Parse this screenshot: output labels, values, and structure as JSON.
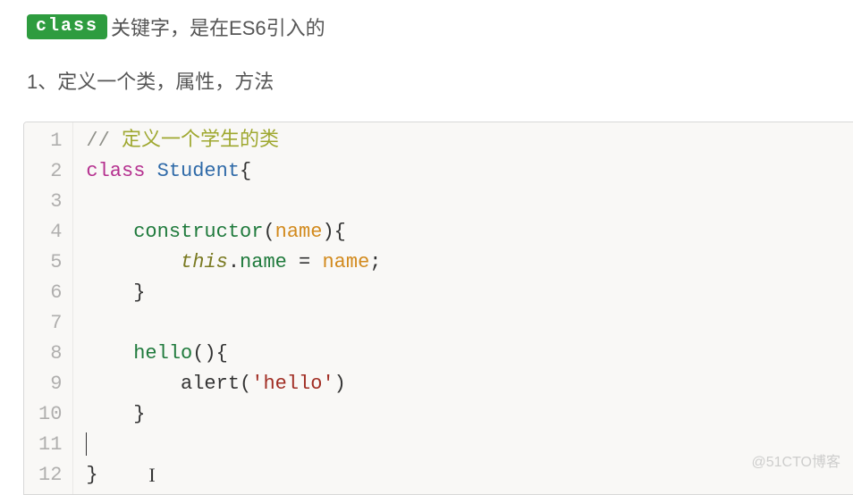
{
  "intro": {
    "badge": "class",
    "rest": "关键字，是在ES6引入的"
  },
  "section": "1、定义一个类，属性，方法",
  "gutter": [
    "1",
    "2",
    "3",
    "4",
    "5",
    "6",
    "7",
    "8",
    "9",
    "10",
    "11",
    "12"
  ],
  "code": {
    "l1_comment": "// ",
    "l1_comment_zh": "定义一个学生的类",
    "l2_class": "class",
    "l2_name": "Student",
    "l4_ctor": "constructor",
    "l4_param": "name",
    "l5_this": "this",
    "l5_prop": "name",
    "l5_eq": " = ",
    "l5_rhs": "name",
    "l8_method": "hello",
    "l9_fn": "alert",
    "l9_str": "'hello'"
  },
  "watermark": "@51CTO博客"
}
